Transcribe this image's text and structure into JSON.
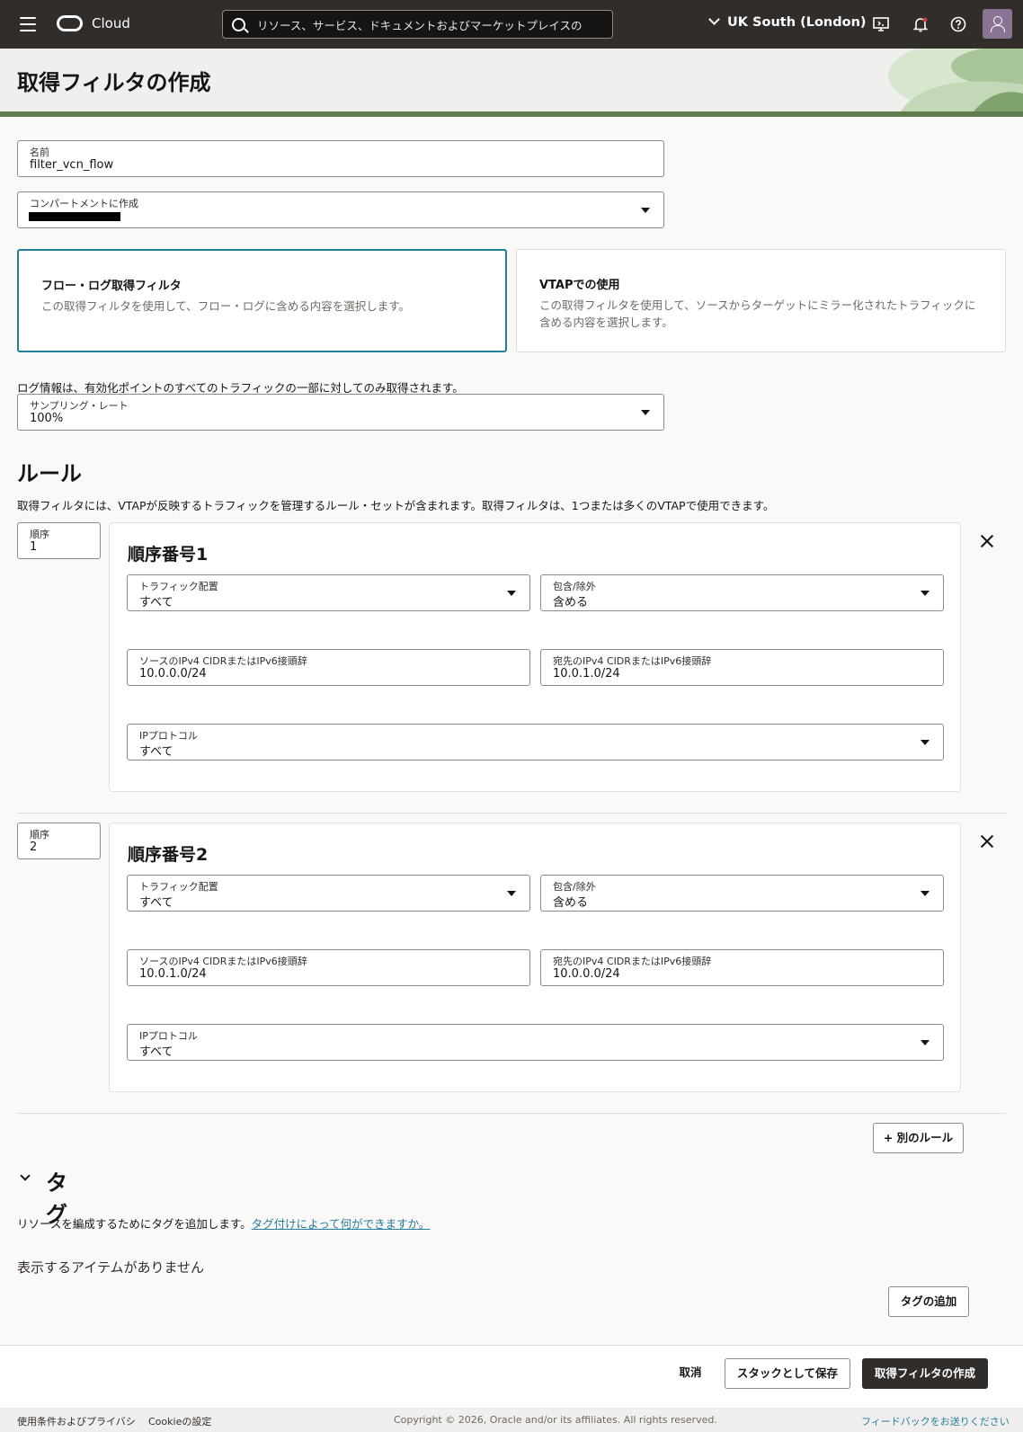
{
  "topbar": {
    "brand": "Cloud",
    "search_placeholder": "リソース、サービス、ドキュメントおよびマーケットプレイスの",
    "region": "UK South (London)",
    "icons": [
      "menu-icon",
      "oracle-logo-icon",
      "search-icon",
      "chevron-down-icon",
      "developer-tools-icon",
      "bell-icon",
      "help-icon",
      "user-avatar-icon"
    ]
  },
  "page": {
    "title": "取得フィルタの作成"
  },
  "form": {
    "name": {
      "label": "名前",
      "value": "filter_vcn_flow"
    },
    "compartment": {
      "label": "コンパートメントに作成",
      "value": ""
    },
    "filter_types": [
      {
        "title": "フロー・ログ取得フィルタ",
        "description": "この取得フィルタを使用して、フロー・ログに含める内容を選択します。",
        "selected": true
      },
      {
        "title": "VTAPでの使用",
        "description": "この取得フィルタを使用して、ソースからターゲットにミラー化されたトラフィックに含める内容を選択します。",
        "selected": false
      }
    ],
    "sampling_note": "ログ情報は、有効化ポイントのすべてのトラフィックの一部に対してのみ取得されます。",
    "sampling": {
      "label": "サンプリング・レート",
      "value": "100%"
    }
  },
  "rules": {
    "heading": "ルール",
    "description": "取得フィルタには、VTAPが反映するトラフィックを管理するルール・セットが含まれます。取得フィルタは、1つまたは多くのVTAPで使用できます。",
    "items": [
      {
        "order_label": "順序",
        "order": "1",
        "title": "順序番号1",
        "traffic_label": "トラフィック配置",
        "traffic": "すべて",
        "action_label": "包含/除外",
        "action": "含める",
        "source_label": "ソースのIPv4 CIDRまたはIPv6接頭辞",
        "source": "10.0.0.0/24",
        "dest_label": "宛先のIPv4 CIDRまたはIPv6接頭辞",
        "dest": "10.0.1.0/24",
        "protocol_label": "IPプロトコル",
        "protocol": "すべて"
      },
      {
        "order_label": "順序",
        "order": "2",
        "title": "順序番号2",
        "traffic_label": "トラフィック配置",
        "traffic": "すべて",
        "action_label": "包含/除外",
        "action": "含める",
        "source_label": "ソースのIPv4 CIDRまたはIPv6接頭辞",
        "source": "10.0.1.0/24",
        "dest_label": "宛先のIPv4 CIDRまたはIPv6接頭辞",
        "dest": "10.0.0.0/24",
        "protocol_label": "IPプロトコル",
        "protocol": "すべて"
      }
    ],
    "add_button": "+ 別のルール"
  },
  "tags": {
    "heading": "タグ",
    "description": "リソースを編成するためにタグを追加します。",
    "link": "タグ付けによって何ができますか。",
    "empty": "表示するアイテムがありません",
    "add_button": "タグの追加"
  },
  "actions": {
    "cancel": "取消",
    "save_stack": "スタックとして保存",
    "create": "取得フィルタの作成"
  },
  "footer": {
    "terms": "使用条件およびプライバシ",
    "cookies": "Cookieの設定",
    "copyright": "Copyright © 2026, Oracle and/or its affiliates. All rights reserved.",
    "feedback": "フィードバックをお送りください"
  },
  "colors": {
    "topbar": "#312d2a",
    "accent": "#227e9e",
    "primary_button": "#312d2a"
  }
}
